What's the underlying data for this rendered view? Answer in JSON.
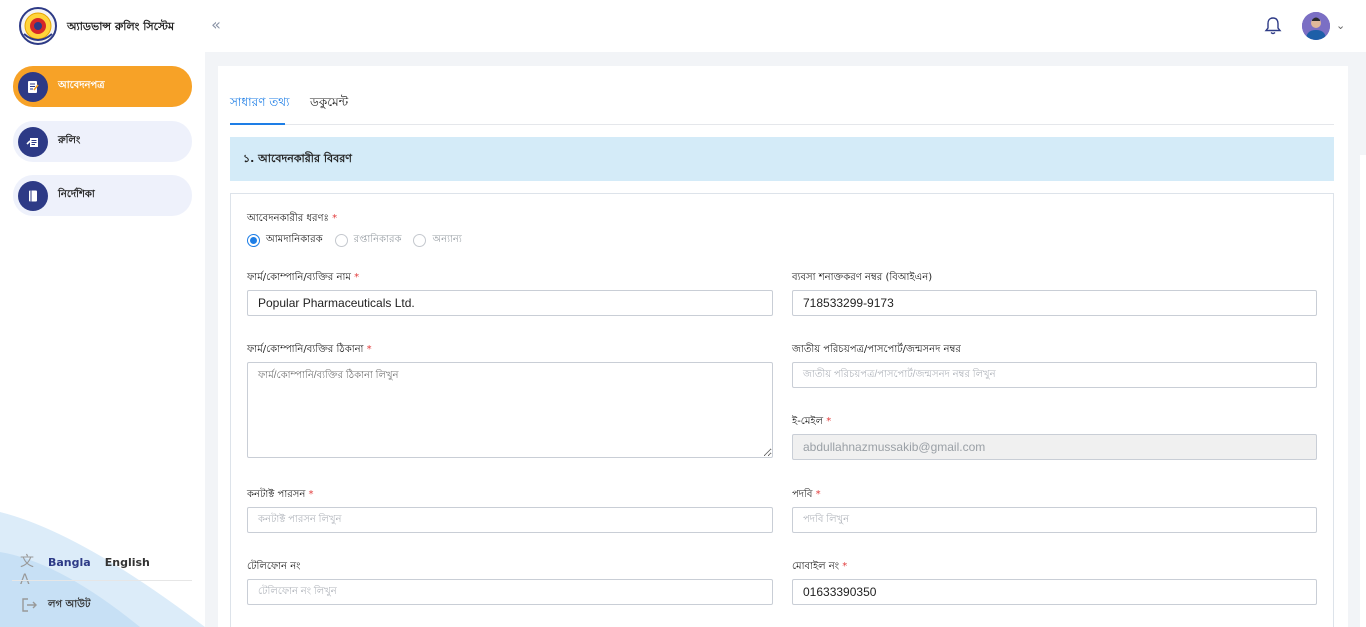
{
  "header": {
    "app_title": "অ্যাডভান্স রুলিং সিস্টেম",
    "collapse_icon": "«"
  },
  "sidebar": {
    "items": [
      {
        "label": "আবেদনপত্র",
        "icon": "application-form-icon",
        "active": true
      },
      {
        "label": "রুলিং",
        "icon": "ruling-icon",
        "active": false
      },
      {
        "label": "নির্দেশিকা",
        "icon": "guideline-book-icon",
        "active": false
      }
    ],
    "language": {
      "bangla": "Bangla",
      "english": "English"
    },
    "logout_label": "লগ আউট"
  },
  "tabs": [
    {
      "label": "সাধারণ তথ্য",
      "active": true
    },
    {
      "label": "ডকুমেন্ট",
      "active": false
    }
  ],
  "section_title": "১. আবেদনকারীর বিবরণ",
  "form": {
    "applicant_type": {
      "label": "আবেদনকারীর ধরণঃ",
      "options": [
        {
          "label": "আমদানিকারক",
          "checked": true
        },
        {
          "label": "রপ্তানিকারক",
          "checked": false
        },
        {
          "label": "অন্যান্য",
          "checked": false
        }
      ]
    },
    "company_name": {
      "label": "ফার্ম/কোম্পানি/ব্যক্তির নাম",
      "value": "Popular Pharmaceuticals Ltd."
    },
    "bin": {
      "label": "ব্যবসা শনাক্তকরণ নম্বর (বিআইএন)",
      "value": "718533299-9173"
    },
    "address": {
      "label": "ফার্ম/কোম্পানি/ব্যক্তির ঠিকানা",
      "placeholder": "ফার্ম/কোম্পানি/ব্যক্তির ঠিকানা লিখুন"
    },
    "nid": {
      "label": "জাতীয় পরিচয়পত্র/পাসপোর্ট/জন্মসনদ নম্বর",
      "placeholder": "জাতীয় পরিচয়পত্র/পাসপোর্ট/জন্মসনদ নম্বর লিখুন"
    },
    "email": {
      "label": "ই-মেইল",
      "value": "abdullahnazmussakib@gmail.com"
    },
    "contact_person": {
      "label": "কনটাক্ট পারসন",
      "placeholder": "কনটাক্ট পারসন লিখুন"
    },
    "designation": {
      "label": "পদবি",
      "placeholder": "পদবি লিখুন"
    },
    "telephone": {
      "label": "টেলিফোন নং",
      "placeholder": "টেলিফোন নং লিখুন"
    },
    "mobile": {
      "label": "মোবাইল নং",
      "value": "01633390350"
    },
    "required_mark": "*"
  },
  "colors": {
    "accent": "#1e7ee6",
    "active_nav": "#f7a227",
    "nav_icon_bg": "#2d3a86",
    "section_bg": "#d4ebf8",
    "required": "#e23b3b"
  }
}
